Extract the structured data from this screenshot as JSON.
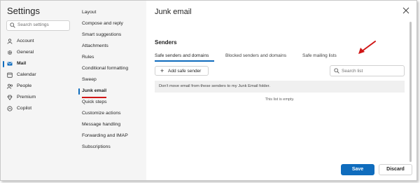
{
  "nav": {
    "title": "Settings",
    "search_placeholder": "Search settings",
    "items": [
      {
        "label": "Account",
        "icon": "person-icon"
      },
      {
        "label": "General",
        "icon": "gear-icon"
      },
      {
        "label": "Mail",
        "icon": "mail-icon",
        "active": true
      },
      {
        "label": "Calendar",
        "icon": "calendar-icon"
      },
      {
        "label": "People",
        "icon": "people-icon"
      },
      {
        "label": "Premium",
        "icon": "diamond-icon"
      },
      {
        "label": "Copilot",
        "icon": "copilot-icon"
      }
    ]
  },
  "mail_settings": {
    "items": [
      "Layout",
      "Compose and reply",
      "Smart suggestions",
      "Attachments",
      "Rules",
      "Conditional formatting",
      "Sweep",
      "Junk email",
      "Quick steps",
      "Customize actions",
      "Message handling",
      "Forwarding and IMAP",
      "Subscriptions"
    ],
    "active": "Junk email"
  },
  "main": {
    "title": "Junk email",
    "section": "Senders",
    "tabs": [
      "Safe senders and domains",
      "Blocked senders and domains",
      "Safe mailing lists"
    ],
    "active_tab": "Safe senders and domains",
    "add_button": "Add safe sender",
    "search_placeholder": "Search list",
    "info_text": "Don't move email from these senders to my Junk Email folder.",
    "empty_text": "This list is empty.",
    "save": "Save",
    "discard": "Discard"
  },
  "colors": {
    "accent": "#0f6cbd",
    "annotation": "#d01616"
  }
}
